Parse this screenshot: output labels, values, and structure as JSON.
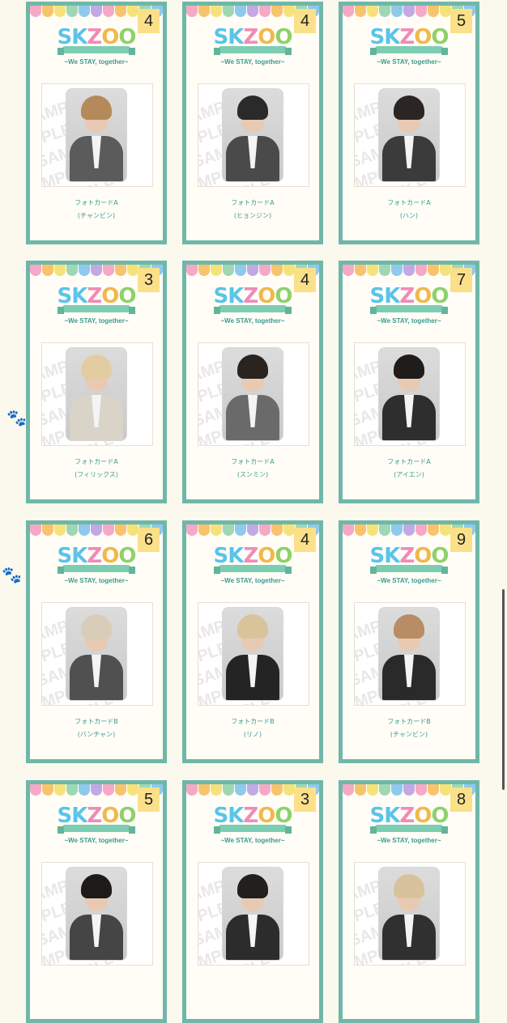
{
  "logo": {
    "word_parts": [
      "SK",
      "Z",
      "O",
      "O"
    ],
    "tagline": "~We STAY, together~"
  },
  "watermark": "SAMPLE",
  "colors": {
    "frame": "#6fb7a8",
    "badge": "#fbe08a",
    "text": "#3a9a90",
    "scallop": [
      "#f5a9c6",
      "#f7c36c",
      "#f5e27a",
      "#9fd7b5",
      "#8fc9ec",
      "#c3a8e6"
    ]
  },
  "cards": [
    {
      "count": "4",
      "type": "フォトカードA",
      "member": "(チャンビン)",
      "hair": "#b58a5b",
      "outfit": "#5b5b5b"
    },
    {
      "count": "4",
      "type": "フォトカードA",
      "member": "(ヒョンジン)",
      "hair": "#2a2a2a",
      "outfit": "#4a4a4a"
    },
    {
      "count": "5",
      "type": "フォトカードA",
      "member": "(ハン)",
      "hair": "#2b2623",
      "outfit": "#3b3b3b"
    },
    {
      "count": "3",
      "type": "フォトカードA",
      "member": "(フィリックス)",
      "hair": "#e2cda3",
      "outfit": "#d9d3c8"
    },
    {
      "count": "4",
      "type": "フォトカードA",
      "member": "(スンミン)",
      "hair": "#2a2421",
      "outfit": "#6a6a6a"
    },
    {
      "count": "7",
      "type": "フォトカードA",
      "member": "(アイエン)",
      "hair": "#1f1c1b",
      "outfit": "#2e2e2e"
    },
    {
      "count": "6",
      "type": "フォトカードB",
      "member": "(バンチャン)",
      "hair": "#d8cdb8",
      "outfit": "#505050"
    },
    {
      "count": "4",
      "type": "フォトカードB",
      "member": "(リノ)",
      "hair": "#d9c39a",
      "outfit": "#242424"
    },
    {
      "count": "9",
      "type": "フォトカードB",
      "member": "(チャンビン)",
      "hair": "#b88d66",
      "outfit": "#2a2a2a"
    },
    {
      "count": "5",
      "type": "",
      "member": "",
      "hair": "#1d1b1a",
      "outfit": "#454545"
    },
    {
      "count": "3",
      "type": "",
      "member": "",
      "hair": "#22201f",
      "outfit": "#2c2c2c"
    },
    {
      "count": "8",
      "type": "",
      "member": "",
      "hair": "#d7c29b",
      "outfit": "#303030"
    }
  ]
}
